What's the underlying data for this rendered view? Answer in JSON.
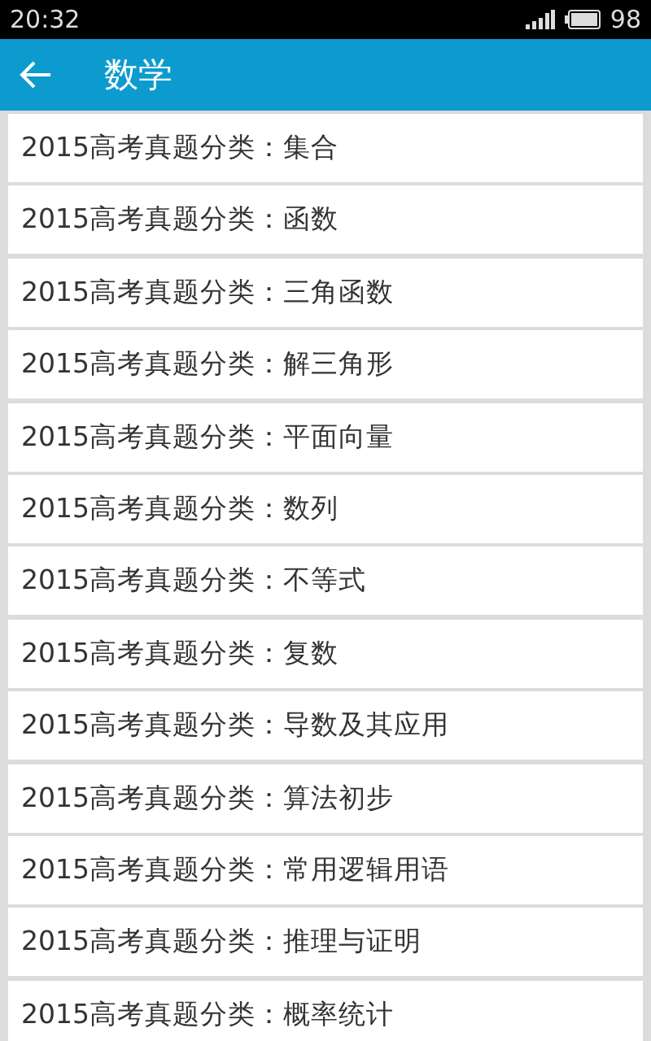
{
  "status_bar": {
    "time": "20:32",
    "battery": "98"
  },
  "app_bar": {
    "title": "数学"
  },
  "items": [
    {
      "label": "2015高考真题分类：集合"
    },
    {
      "label": "2015高考真题分类：函数"
    },
    {
      "label": "2015高考真题分类：三角函数"
    },
    {
      "label": "2015高考真题分类：解三角形"
    },
    {
      "label": "2015高考真题分类：平面向量"
    },
    {
      "label": "2015高考真题分类：数列"
    },
    {
      "label": "2015高考真题分类：不等式"
    },
    {
      "label": "2015高考真题分类：复数"
    },
    {
      "label": "2015高考真题分类：导数及其应用"
    },
    {
      "label": "2015高考真题分类：算法初步"
    },
    {
      "label": "2015高考真题分类：常用逻辑用语"
    },
    {
      "label": "2015高考真题分类：推理与证明"
    },
    {
      "label": "2015高考真题分类：概率统计"
    }
  ]
}
